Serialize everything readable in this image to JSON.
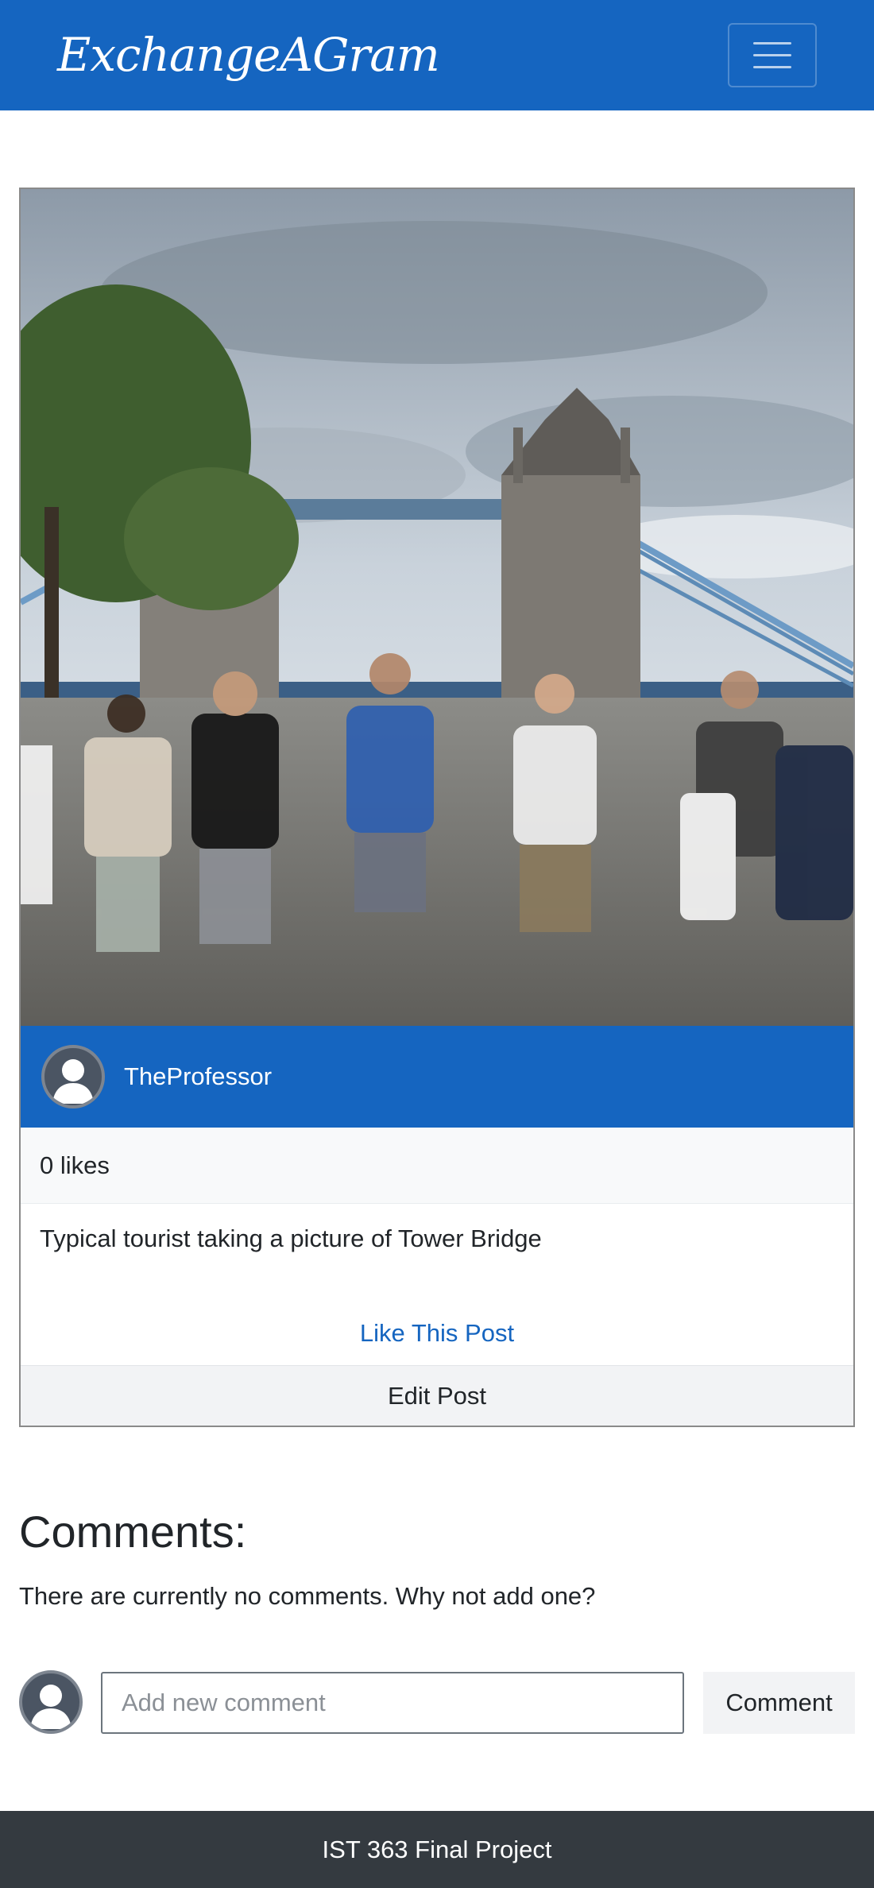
{
  "navbar": {
    "brand": "ExchangeAGram",
    "toggle_icon": "hamburger-menu-icon",
    "color": "#1565c0"
  },
  "post": {
    "image_icon": "tower-bridge-photo",
    "username": "TheProfessor",
    "likes": "0 likes",
    "caption": "Typical tourist taking a picture of Tower Bridge",
    "like_label": "Like This Post",
    "edit_label": "Edit Post"
  },
  "comments": {
    "title": "Comments:",
    "empty_text": "There are currently no comments. Why not add one?",
    "input_placeholder": "Add new comment",
    "input_value": "",
    "submit_label": "Comment"
  },
  "footer": {
    "text": "IST 363 Final Project"
  },
  "colors": {
    "primary": "#1565c0",
    "footer": "#343a40",
    "light": "#f8f9fa"
  }
}
